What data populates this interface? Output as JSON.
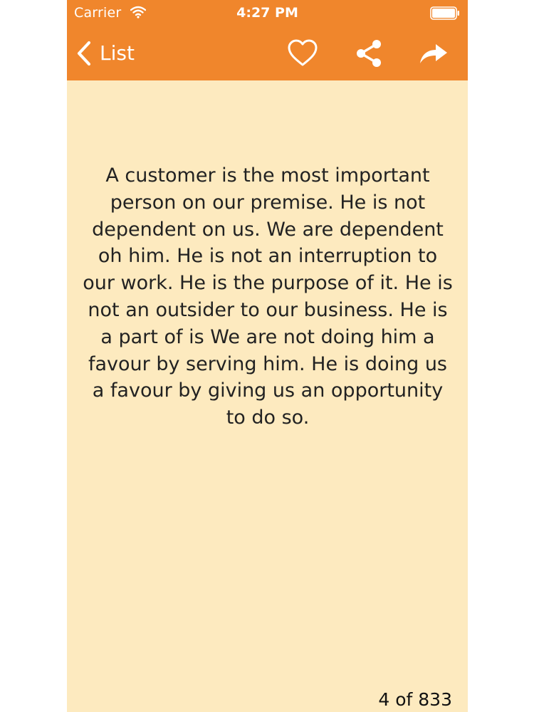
{
  "status_bar": {
    "carrier": "Carrier",
    "time": "4:27 PM",
    "wifi_icon": "wifi-icon",
    "battery_icon": "battery-icon"
  },
  "nav": {
    "back_label": "List",
    "back_icon": "chevron-left-icon",
    "actions": [
      "heart-icon",
      "share-icon",
      "forward-arrow-icon"
    ]
  },
  "quote": {
    "text": "A customer is the most important person on our premise. He is not dependent on us. We are dependent oh him. He is not an interruption to our work. He is the purpose of it. He is not an outsider to our business. He is a part of is We are not doing him a favour by serving him. He is doing us a favour by giving us an opportunity to do so."
  },
  "pager": {
    "label": "4 of 833"
  },
  "colors": {
    "header": "#f0862c",
    "background": "#fdeabf",
    "text": "#222222"
  }
}
